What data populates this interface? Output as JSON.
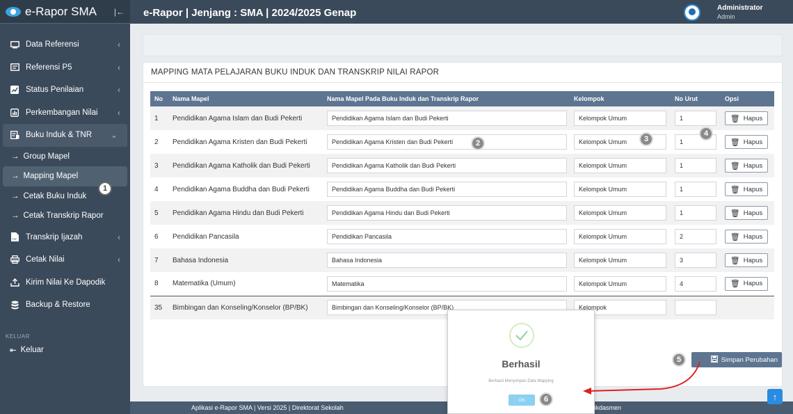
{
  "app": {
    "brand": "e-Rapor SMA",
    "header_title": "e-Rapor | Jenjang : SMA | 2024/2025 Genap",
    "user_name": "Administrator",
    "user_role": "Admin"
  },
  "sidebar": {
    "items": [
      {
        "label": "Data Referensi",
        "icon": "monitor-icon"
      },
      {
        "label": "Referensi P5",
        "icon": "monitor-icon"
      },
      {
        "label": "Status Penilaian",
        "icon": "chart-line-icon"
      },
      {
        "label": "Perkembangan Nilai",
        "icon": "bar-chart-icon"
      },
      {
        "label": "Buku Induk & TNR",
        "icon": "book-icon"
      }
    ],
    "subitems": [
      {
        "label": "Group Mapel"
      },
      {
        "label": "Mapping Mapel"
      },
      {
        "label": "Cetak Buku Induk"
      },
      {
        "label": "Cetak Transkrip Rapor"
      }
    ],
    "items2": [
      {
        "label": "Transkrip Ijazah",
        "icon": "file-pdf-icon"
      },
      {
        "label": "Cetak Nilai",
        "icon": "printer-icon"
      },
      {
        "label": "Kirim Nilai Ke Dapodik",
        "icon": "upload-icon"
      },
      {
        "label": "Backup & Restore",
        "icon": "database-icon"
      }
    ],
    "section_label": "KELUAR",
    "logout_label": "Keluar"
  },
  "card": {
    "title": "MAPPING MATA PELAJARAN BUKU INDUK DAN TRANSKRIP NILAI RAPOR"
  },
  "table": {
    "headers": [
      "No",
      "Nama Mapel",
      "Nama Mapel Pada Buku Induk dan Transkrip Rapor",
      "Kelompok",
      "No Urut",
      "Opsi"
    ],
    "rows": [
      {
        "no": "1",
        "mapel": "Pendidikan Agama Islam dan Budi Pekerti",
        "mapel_bi": "Pendidikan Agama Islam dan Budi Pekerti",
        "kelompok": "Kelompok Umum",
        "urut": "1",
        "opsi": "Hapus"
      },
      {
        "no": "2",
        "mapel": "Pendidikan Agama Kristen dan Budi Pekerti",
        "mapel_bi": "Pendidikan Agama Kristen dan Budi Pekerti",
        "kelompok": "Kelompok Umum",
        "urut": "1",
        "opsi": "Hapus"
      },
      {
        "no": "3",
        "mapel": "Pendidikan Agama Katholik dan Budi Pekerti",
        "mapel_bi": "Pendidikan Agama Katholik dan Budi Pekerti",
        "kelompok": "Kelompok Umum",
        "urut": "1",
        "opsi": "Hapus"
      },
      {
        "no": "4",
        "mapel": "Pendidikan Agama Buddha dan Budi Pekerti",
        "mapel_bi": "Pendidikan Agama Buddha dan Budi Pekerti",
        "kelompok": "Kelompok Umum",
        "urut": "1",
        "opsi": "Hapus"
      },
      {
        "no": "5",
        "mapel": "Pendidikan Agama Hindu dan Budi Pekerti",
        "mapel_bi": "Pendidikan Agama Hindu dan Budi Pekerti",
        "kelompok": "Kelompok Umum",
        "urut": "1",
        "opsi": "Hapus"
      },
      {
        "no": "6",
        "mapel": "Pendidikan Pancasila",
        "mapel_bi": "Pendidikan Pancasila",
        "kelompok": "Kelompok Umum",
        "urut": "2",
        "opsi": "Hapus"
      },
      {
        "no": "7",
        "mapel": "Bahasa Indonesia",
        "mapel_bi": "Bahasa Indonesia",
        "kelompok": "Kelompok Umum",
        "urut": "3",
        "opsi": "Hapus"
      },
      {
        "no": "8",
        "mapel": "Matematika (Umum)",
        "mapel_bi": "Matematika",
        "kelompok": "Kelompok Umum",
        "urut": "4",
        "opsi": "Hapus"
      },
      {
        "no": "35",
        "mapel": "Bimbingan dan Konseling/Konselor (BP/BK)",
        "mapel_bi": "Bimbingan dan Konseling/Konselor (BP/BK)",
        "kelompok": "Kelompok",
        "urut": "",
        "opsi": ""
      }
    ]
  },
  "save_button": "Simpan Perubahan",
  "footer": {
    "left": "Aplikasi e-Rapor SMA | Versi 2025 | Direktorat Sekolah",
    "right": "mendikdasmen"
  },
  "modal": {
    "title": "Berhasil",
    "message": "Berhasil Menyimpan Data Mapping",
    "ok": "OK"
  },
  "steps": [
    "1",
    "2",
    "3",
    "4",
    "5",
    "6"
  ],
  "colors": {
    "sidebar": "#3b4a5a",
    "table_header": "#5d7590",
    "accent": "#2a8be0",
    "success": "#8cd0a0",
    "arrow": "#e02020"
  }
}
